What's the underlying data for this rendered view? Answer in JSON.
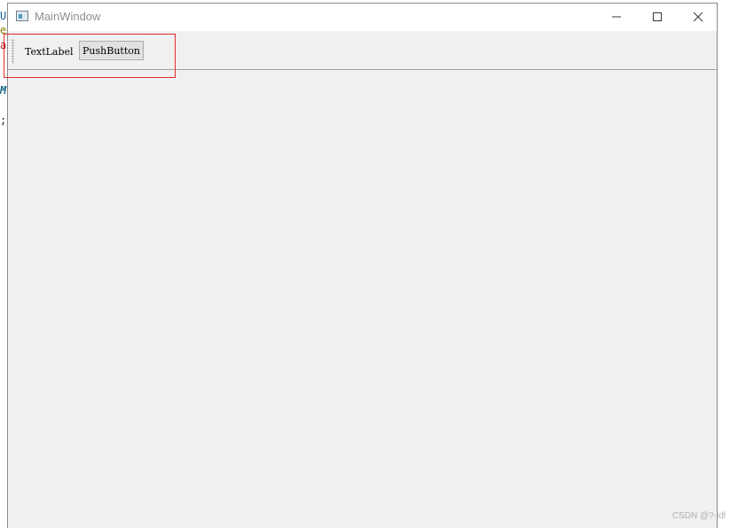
{
  "background_text": {
    "line1": "U",
    "line2": "e",
    "line3": "a",
    "line4": "M",
    "line5": ";"
  },
  "window": {
    "title": "MainWindow",
    "icon": "app-window-icon",
    "controls": {
      "minimize": "minimize-icon",
      "maximize": "maximize-icon",
      "close": "close-icon"
    }
  },
  "toolbar": {
    "text_label": "TextLabel",
    "push_button": "PushButton"
  },
  "annotation": {
    "highlight_color": "#e02a2a"
  },
  "watermark": "CSDN @?-ldl"
}
